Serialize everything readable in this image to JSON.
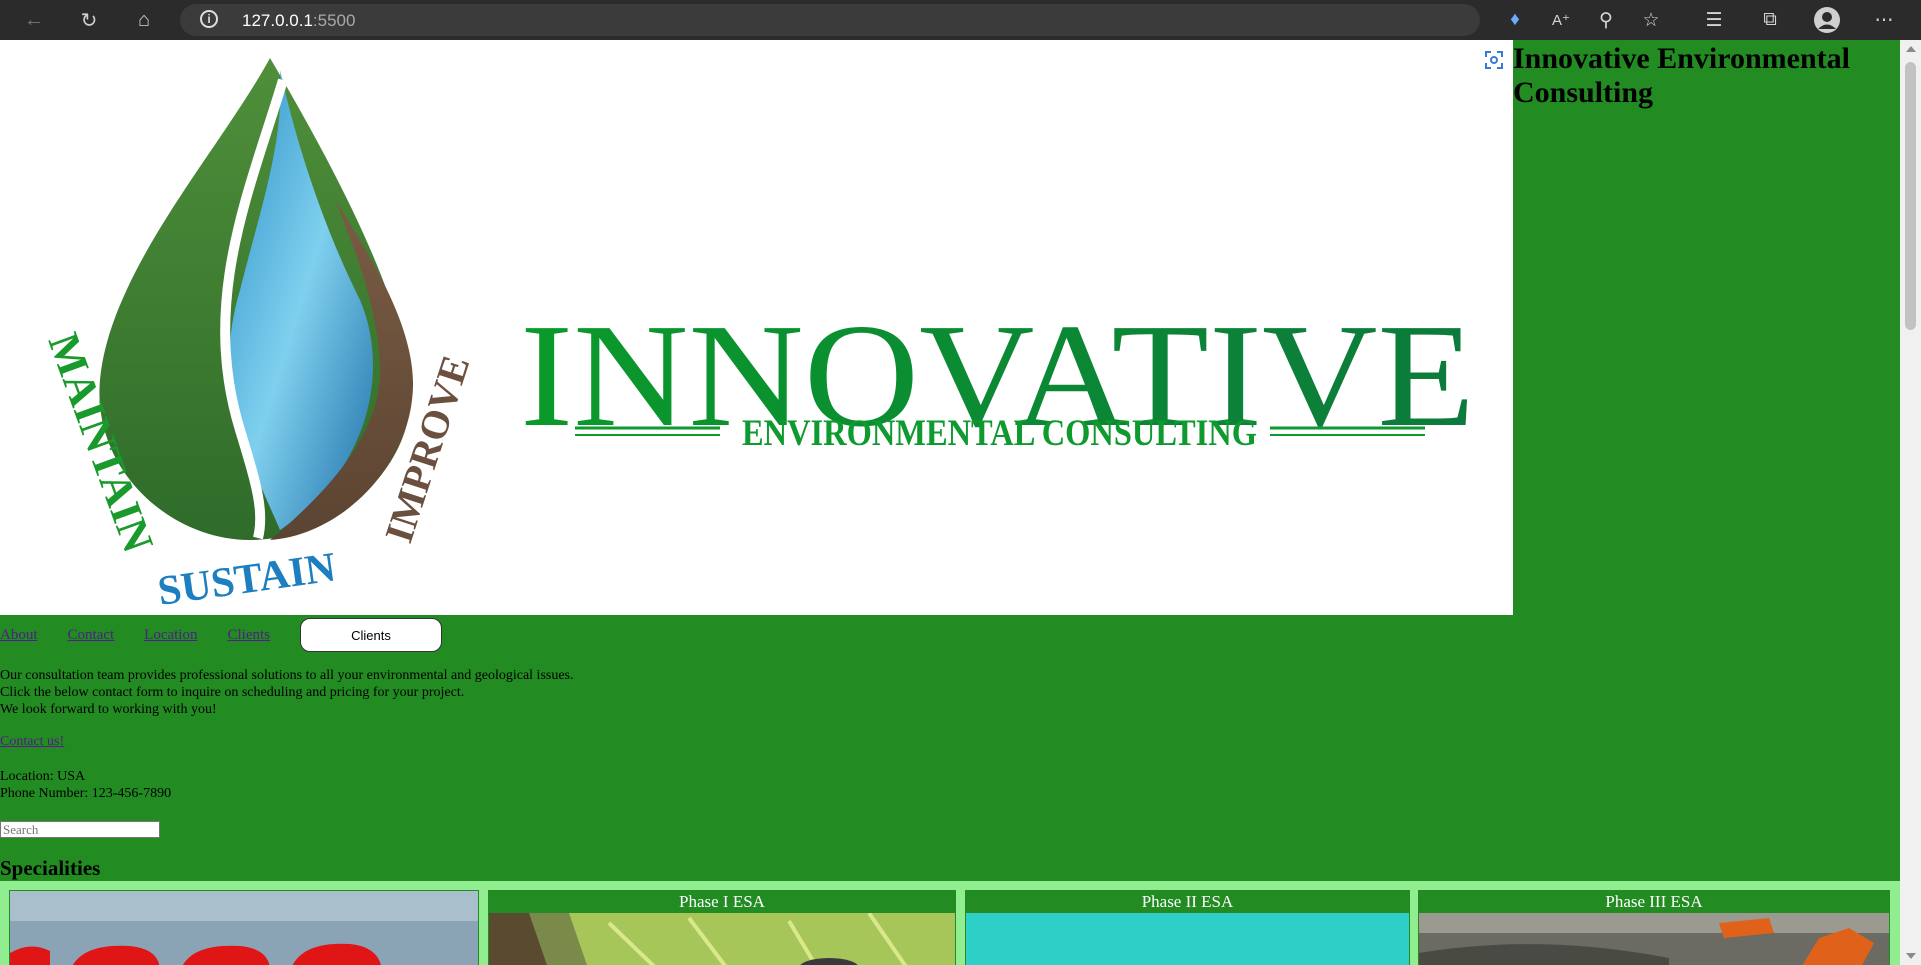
{
  "browser": {
    "url_host": "127.0.0.1",
    "url_port": ":5500"
  },
  "hero": {
    "logo_word": "INNOVATIVE",
    "logo_sub": "ENVIRONMENTAL CONSULTING",
    "arc_left": "MAINTAIN",
    "arc_bottom": "SUSTAIN",
    "arc_right": "IMPROVE"
  },
  "site_title": "Innovative Environmental Consulting",
  "nav": {
    "links": [
      "About",
      "Contact",
      "Location",
      "Clients"
    ],
    "button_label": "Clients"
  },
  "intro": {
    "line1": "Our consultation team provides professional solutions to all your environmental and geological issues.",
    "line2": "Click the below contact form to inquire on scheduling and pricing for your project.",
    "line3": "We look forward to working with you!"
  },
  "contact_link": "Contact us!",
  "location": {
    "location_line": "Location: USA",
    "phone_line": "Phone Number: 123-456-7890"
  },
  "search": {
    "placeholder": "Search"
  },
  "specialities": {
    "heading": "Specialities",
    "cards": [
      {
        "title": ""
      },
      {
        "title": "Phase I ESA"
      },
      {
        "title": "Phase II ESA"
      },
      {
        "title": "Phase III ESA"
      }
    ]
  },
  "colors": {
    "page_bg": "#228b22",
    "band_bg": "#90ee90",
    "link": "#551a8b"
  }
}
